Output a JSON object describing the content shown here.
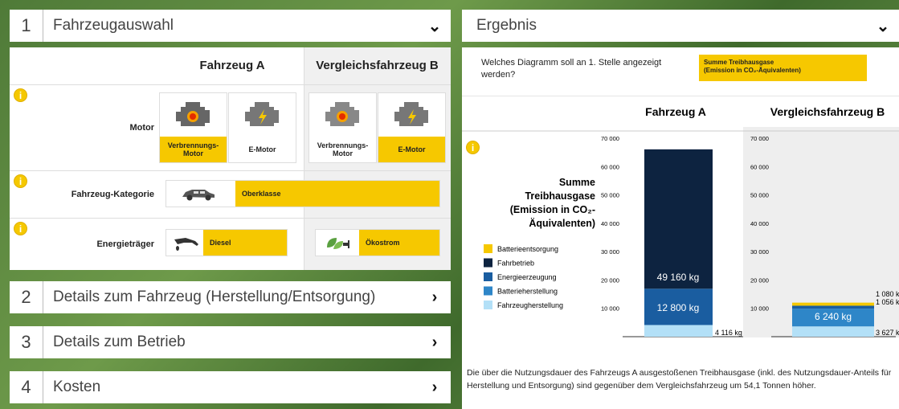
{
  "panels": [
    {
      "num": "1",
      "title": "Fahrzeugauswahl"
    },
    {
      "num": "2",
      "title": "Details zum Fahrzeug (Herstellung/Entsorgung)"
    },
    {
      "num": "3",
      "title": "Details zum Betrieb"
    },
    {
      "num": "4",
      "title": "Kosten"
    }
  ],
  "result": {
    "title": "Ergebnis"
  },
  "selection": {
    "col_a": "Fahrzeug A",
    "col_b": "Vergleichsfahrzeug B",
    "motor_label": "Motor",
    "category_label": "Fahrzeug-Kategorie",
    "energy_label": "Energieträger",
    "a_motor1": "Verbrennungs-Motor",
    "a_motor2": "E-Motor",
    "b_motor1": "Verbrennungs-Motor",
    "b_motor2": "E-Motor",
    "category_value": "Oberklasse",
    "energy_a": "Diesel",
    "energy_b": "Ökostrom"
  },
  "question": {
    "text": "Welches Diagramm soll an 1. Stelle angezeigt werden?",
    "answer_line1": "Summe Treibhausgase",
    "answer_line2": "(Emission in CO₂-Äquivalenten)"
  },
  "chart_data": {
    "type": "bar",
    "stacked": true,
    "categories": [
      "Fahrzeug A",
      "Vergleichsfahrzeug B"
    ],
    "ylabel_lines": [
      "Summe",
      "Treibhausgase",
      "(Emission in CO₂-",
      "Äquivalenten)"
    ],
    "ylim": [
      0,
      70000
    ],
    "ticks": [
      "70 000",
      "60 000",
      "50 000",
      "40 000",
      "30 000",
      "20 000",
      "10 000"
    ],
    "series": [
      {
        "name": "Fahrzeugherstellung",
        "color": "#b3e0f7",
        "values": [
          4116,
          3627
        ]
      },
      {
        "name": "Batterieherstellung",
        "color": "#2e86c8",
        "values": [
          0,
          6240
        ]
      },
      {
        "name": "Energieerzeugung",
        "color": "#1a5da0",
        "values": [
          12800,
          1056
        ]
      },
      {
        "name": "Fahrbetrieb",
        "color": "#0d2340",
        "values": [
          49160,
          0
        ]
      },
      {
        "name": "Batterieentsorgung",
        "color": "#f6c800",
        "values": [
          0,
          1080
        ]
      }
    ],
    "legend_order": [
      "Batterieentsorgung",
      "Fahrbetrieb",
      "Energieerzeugung",
      "Batterieherstellung",
      "Fahrzeugherstellung"
    ],
    "labels": {
      "a_fahrbetrieb": "49 160 kg",
      "a_energie": "12 800 kg",
      "a_herstellung": "4 116 kg",
      "b_batt": "6 240 kg",
      "b_herstellung": "3 627 kg",
      "b_entsorgung": "1 080 kg",
      "b_energie": "1 056 kg"
    }
  },
  "summary": "Die über die Nutzungsdauer des Fahrzeugs A ausgestoßenen Treibhausgase (inkl. des Nutzungsdauer-Anteils für Herstellung und Entsorgung) sind gegenüber dem Vergleichsfahrzeug um 54,1 Tonnen höher."
}
